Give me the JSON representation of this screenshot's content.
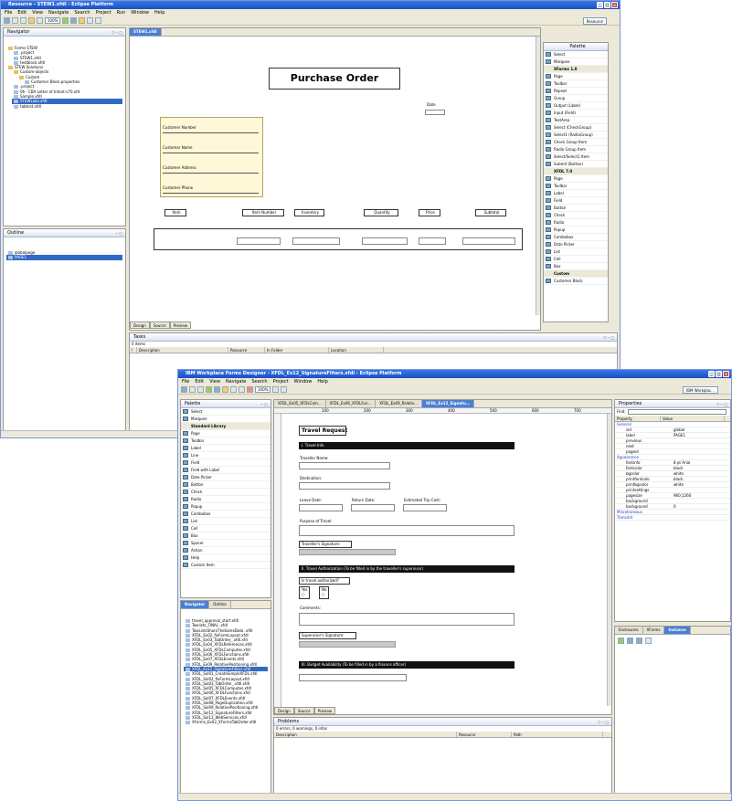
{
  "back": {
    "title": "Resource - STEW1.xfdl - Eclipse Platform",
    "menu": [
      "File",
      "Edit",
      "View",
      "Navigate",
      "Search",
      "Project",
      "Run",
      "Window",
      "Help"
    ],
    "zoom": "100%",
    "perspective": "Resource",
    "navigator": {
      "title": "Navigator",
      "items": [
        "Forms STEW",
        ".project",
        "STEW1.xfdl",
        "testblock.xfdl",
        "STEW Solutions",
        "Custom-objects",
        "Custom",
        "Customer Block.properties",
        ".project",
        "06 - CBA Letter of Intent-v70.xfd",
        "Sample.xfdl",
        "STEWLabs.xfdl",
        "tabtest.xfdl"
      ]
    },
    "outline": {
      "title": "Outline",
      "items": [
        "globalpage",
        "PAGE1"
      ]
    },
    "editor_tab": "STEW1.xfdl",
    "form": {
      "heading": "Purchase Order",
      "date_label": "Date",
      "customer_fields": [
        "Customer Number",
        "Customer Name",
        "Customer Address",
        "Customer Phone"
      ],
      "columns": [
        "Item",
        "Item Number",
        "Inventory",
        "Quantity",
        "Price",
        "Subtotal"
      ]
    },
    "bottom_tabs": [
      "Design",
      "Source",
      "Preview"
    ],
    "palette": {
      "title": "Palette",
      "tools": [
        "Select",
        "Marquee"
      ],
      "group1": "XForms 1.0",
      "items1": [
        "Page",
        "Toolbar",
        "Repeat",
        "Group",
        "Output (Label)",
        "Input (Field)",
        "TextArea",
        "Select (CheckGroup)",
        "Select1 (RadioGroup)",
        "Check Group Item",
        "Radio Group Item",
        "Select/Select1 Item",
        "Submit (Button)"
      ],
      "group2": "XFDL 7.0",
      "items2": [
        "Page",
        "Toolbar",
        "Label",
        "Field",
        "Button",
        "Check",
        "Radio",
        "Popup",
        "Combobox",
        "Date Picker",
        "List",
        "Cell",
        "Box"
      ],
      "group3": "Custom",
      "items3": [
        "Customer Block"
      ]
    },
    "tasks": {
      "title": "Tasks",
      "count": "0 items",
      "columns": [
        "!",
        "Description",
        "Resource",
        "In Folder",
        "Location"
      ]
    }
  },
  "front": {
    "title": "IBM Workplace Forms Designer - XFDL_Ex12_SignatureFilters.xfdl - Eclipse Platform",
    "menu": [
      "File",
      "Edit",
      "View",
      "Navigate",
      "Search",
      "Project",
      "Window",
      "Help"
    ],
    "zoom": "100%",
    "perspective": "IBM Workplac...",
    "palette": {
      "title": "Palette",
      "tools": [
        "Select",
        "Marquee"
      ],
      "group": "Standard Library",
      "items": [
        "Page",
        "Toolbar",
        "Label",
        "Line",
        "Field",
        "Field with Label",
        "Date Picker",
        "Button",
        "Check",
        "Radio",
        "Popup",
        "Combobox",
        "List",
        "Cell",
        "Box",
        "Spacer",
        "Action",
        "Help",
        "Custom Item"
      ]
    },
    "navigator": {
      "tabs": [
        "Navigator",
        "Outline"
      ],
      "items": [
        "travel_approval_start.xfdl",
        "Twolists_FINAL .xfdl",
        "TwoListsShareTheSameData .xfdl",
        "XFDL_Ex02_fixFormLayout.xfdl",
        "XFDL_Ex03_TabOrder_.xfdl.xfd",
        "XFDL_Ex04_XFDLReferences.xfdl",
        "XFDL_Ex05_XFDLComputes.xfdl",
        "XFDL_Ex06_XFDLFunctions.xfdl",
        "XFDL_Ex07_XFDLEvents.xfdl",
        "XFDL_Ex09_RelativePositioning.xfdl",
        "XFDL_Ex12_SignatureFilters.xfdl",
        "XFDL_Sol01_CreateSimpleXFDL.xfdl",
        "XFDL_Sol02_fixFormLayout.xfdl",
        "XFDL_Sol03_TabOrder_.xfdl.xfdl",
        "XFDL_Sol05_XFDLComputes.xfdl",
        "XFDL_Sol06_XFDLFunctions.xfdl",
        "XFDL_Sol07_XFDLEvents.xfdl",
        "XFDL_Sol08_PageDuplication.xfdl",
        "XFDL_Sol09_RelativePositioning.xfdl",
        "XFDL_Sol12_SignatureFilters.xfdl",
        "XFDL_Sol13_WebServices.xfdl",
        "XForms_Ex02_XFormsTabOrder.xfdl"
      ]
    },
    "editor_tabs": [
      "XFDL_Ex05_XFDLCom...",
      "XFDL_Ex06_XFDLFun...",
      "XFDL_Ex09_Relativ...",
      "XFDL_Ex12_Signatu..."
    ],
    "ruler": [
      "100",
      "200",
      "300",
      "400",
      "500",
      "600",
      "700"
    ],
    "form": {
      "heading": "Travel Request",
      "s1": "I. Travel Info",
      "traveller_name": "Traveller Name:",
      "destination": "Destination:",
      "leave": "Leave Date:",
      "return": "Return Date:",
      "cost": "Estimated Trip Cost:",
      "purpose": "Purpose of Travel:",
      "trav_sig": "Traveller's Signature:",
      "s2": "II. Travel Authorization (To be filled in by the traveller's supervisor)",
      "authorized": "Is travel authorized?",
      "yes": "Yes",
      "no": "No",
      "comments": "Comments:",
      "sup_sig": "Supervisor's Signature:",
      "s3": "III. Budget Availability (To be filled in by a finance officer)"
    },
    "bottom_tabs": [
      "Design",
      "Source",
      "Preview"
    ],
    "problems": {
      "title": "Problems",
      "summary": "0 errors, 0 warnings, 0 infos",
      "columns": [
        "Description",
        "Resource",
        "Path"
      ]
    },
    "properties": {
      "title": "Properties",
      "find": "Find:",
      "columns": [
        "Property",
        "Value"
      ],
      "rows": [
        {
          "name": "General",
          "value": ""
        },
        {
          "name": "sid",
          "value": "global"
        },
        {
          "name": "label",
          "value": "PAGE1"
        },
        {
          "name": "previous",
          "value": ""
        },
        {
          "name": "next",
          "value": ""
        },
        {
          "name": "pageid",
          "value": ""
        },
        {
          "name": "Appearance",
          "value": ""
        },
        {
          "name": "fontinfo",
          "value": "8 pt Arial"
        },
        {
          "name": "fontcolor",
          "value": "black"
        },
        {
          "name": "bgcolor",
          "value": "white"
        },
        {
          "name": "printfontcolo",
          "value": "black"
        },
        {
          "name": "printbgcolor",
          "value": "white"
        },
        {
          "name": "printsettings",
          "value": ""
        },
        {
          "name": "pagesize",
          "value": "960;1260"
        },
        {
          "name": "background",
          "value": ""
        },
        {
          "name": "background",
          "value": "0"
        },
        {
          "name": "Miscellaneous",
          "value": ""
        },
        {
          "name": "Transmit",
          "value": ""
        }
      ]
    },
    "instance_tabs": [
      "Enclosures",
      "XForms",
      "Instance"
    ]
  }
}
